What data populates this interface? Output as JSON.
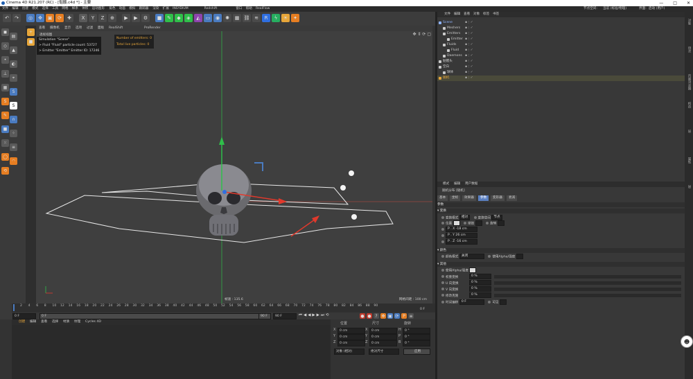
{
  "window": {
    "title": "Cinema 4D R21.207 (RC) - [骷髅.c4d *] - 主要",
    "controls": [
      "—",
      "□",
      "✕"
    ]
  },
  "menubar": {
    "items": [
      "文件",
      "编辑",
      "创建",
      "模式",
      "选择",
      "工具",
      "网格",
      "样条",
      "体积",
      "运动图形",
      "角色",
      "动画",
      "模拟",
      "跟踪器",
      "渲染",
      "扩展",
      "INSYDIUM",
      "Redshift",
      "窗口",
      "帮助",
      "RealFlow"
    ],
    "right_label": "节点空间:",
    "right_value": "当前 (标准/物理)",
    "layout_label": "界面:",
    "layout_value": "启动 (用户)"
  },
  "toolbar": {
    "icons": [
      "undo-icon",
      "redo-icon",
      "live-select-icon",
      "move-icon",
      "scale-icon",
      "rotate-icon",
      "recent-icon",
      "x-axis-icon",
      "y-axis-icon",
      "z-axis-icon",
      "coord-icon",
      "render-view-icon",
      "render-pic-icon",
      "render-settings-icon",
      "cube-icon",
      "pen-icon",
      "subdivide-icon",
      "cloner-icon",
      "deformer-icon",
      "floor-icon",
      "camera-icon",
      "light-icon",
      "grid-icon",
      "chain-icon",
      "fluid-icon",
      "rf-icon",
      "bolt-icon",
      "sun-icon",
      "star-icon"
    ],
    "axis_labels": [
      "X",
      "Y",
      "Z"
    ]
  },
  "viewport": {
    "menu": [
      "查看",
      "摄像机",
      "显示",
      "选项",
      "过滤",
      "面板",
      "RealShift",
      "ProRender"
    ],
    "overlay_label": "透视视图",
    "info_lines": [
      "Simulation \"Scene\"",
      "> Fluid \"Fluid\" particle count: 53727",
      "> Emitter \"Emitter\" Emitter ID: 17246"
    ],
    "stats": [
      "Number of emitters: 0",
      "Total live particles: 0"
    ],
    "speed_label": "帧速 : 135.6",
    "grid_label": "网格间距 : 100 cm",
    "colors": {
      "x_axis": "#e0392c",
      "y_axis": "#2fbf4a",
      "z_axis": "#2f6fe0",
      "bg": "#3f3f3f"
    }
  },
  "timeline": {
    "ticks": [
      "2",
      "4",
      "6",
      "8",
      "10",
      "12",
      "14",
      "16",
      "18",
      "20",
      "22",
      "24",
      "26",
      "28",
      "30",
      "32",
      "34",
      "36",
      "38",
      "40",
      "42",
      "44",
      "46",
      "48",
      "50",
      "52",
      "54",
      "56",
      "58",
      "60",
      "62",
      "64",
      "66",
      "68",
      "70",
      "72",
      "74",
      "76",
      "78",
      "80",
      "82",
      "84",
      "86",
      "88",
      "90"
    ],
    "current_frame": "0 F",
    "start_frame": "0 F",
    "end_frame": "90 F",
    "preview_end": "90 F",
    "frame_readout": "0 F"
  },
  "materials": {
    "tabs": [
      "创建",
      "编辑",
      "查看",
      "选择",
      "材质",
      "纹理",
      "Cycles 4D"
    ]
  },
  "coordinates": {
    "headers": [
      "位置",
      "尺寸",
      "旋转"
    ],
    "rows": [
      {
        "axis": "X",
        "pos": "0 cm",
        "size": "0 cm",
        "rot_label": "H",
        "rot": "0 °"
      },
      {
        "axis": "Y",
        "pos": "0 cm",
        "size": "0 cm",
        "rot_label": "P",
        "rot": "0 °"
      },
      {
        "axis": "Z",
        "pos": "0 cm",
        "size": "0 cm",
        "rot_label": "B",
        "rot": "0 °"
      }
    ],
    "mode1": "对象 (相对)",
    "mode2": "绝对尺寸",
    "apply": "应用"
  },
  "object_manager": {
    "menu": [
      "文件",
      "编辑",
      "查看",
      "对象",
      "标签",
      "书签"
    ],
    "objects": [
      {
        "name": "Scene",
        "indent": 0,
        "color": "#8fb4ff"
      },
      {
        "name": "Meshers",
        "indent": 1,
        "color": "#cccccc"
      },
      {
        "name": "Emitters",
        "indent": 1,
        "color": "#cccccc"
      },
      {
        "name": "Emitter",
        "indent": 2,
        "color": "#cccccc"
      },
      {
        "name": "Fluids",
        "indent": 1,
        "color": "#cccccc"
      },
      {
        "name": "Fluid",
        "indent": 2,
        "color": "#cccccc"
      },
      {
        "name": "Daemons",
        "indent": 1,
        "color": "#cccccc"
      },
      {
        "name": "骷髅头",
        "indent": 0,
        "color": "#cccccc"
      },
      {
        "name": "空白",
        "indent": 0,
        "color": "#cccccc"
      },
      {
        "name": "球体",
        "indent": 1,
        "color": "#cccccc"
      },
      {
        "name": "随机",
        "indent": 0,
        "color": "#e7a63a"
      }
    ]
  },
  "attributes": {
    "menu": [
      "模式",
      "编辑",
      "用户数据"
    ],
    "object_title": "随机分布 [随机]",
    "tabs": [
      "基本",
      "坐标",
      "效果器",
      "参数",
      "变形器",
      "衰减"
    ],
    "active_tab": "参数",
    "section_params": "参数",
    "sub_transform": "▾ 变换",
    "transform_mode_label": "变换模式",
    "transform_mode_value": "相对",
    "transform_space_label": "变换空间",
    "transform_space_value": "节点",
    "position_label": "位置",
    "scale_label": "缩放",
    "rotate_label": "旋转",
    "px": "P . X  -18 cm",
    "py": "P . Y  26 cm",
    "pz": "P . Z  -16 cm",
    "sub_color": "▾ 颜色",
    "color_mode_label": "颜色模式",
    "color_mode_value": "关闭",
    "use_alpha_label": "使用Alpha/强度",
    "sub_other": "▾ 其他",
    "use_alpha_strength": "使用Alpha/强度",
    "weight_label": "权重变换",
    "weight_value": "0 %",
    "u_label": "U 向变换",
    "u_value": "0 %",
    "v_label": "V 向变换",
    "v_value": "0 %",
    "mod_label": "修改克隆",
    "mod_value": "0 %",
    "time_label": "时间偏移",
    "time_value": "0 F",
    "visible_label": "可见"
  },
  "side_labels": [
    "对象",
    "场次",
    "内容浏览器",
    "构造",
    "层",
    "属性",
    "层"
  ]
}
